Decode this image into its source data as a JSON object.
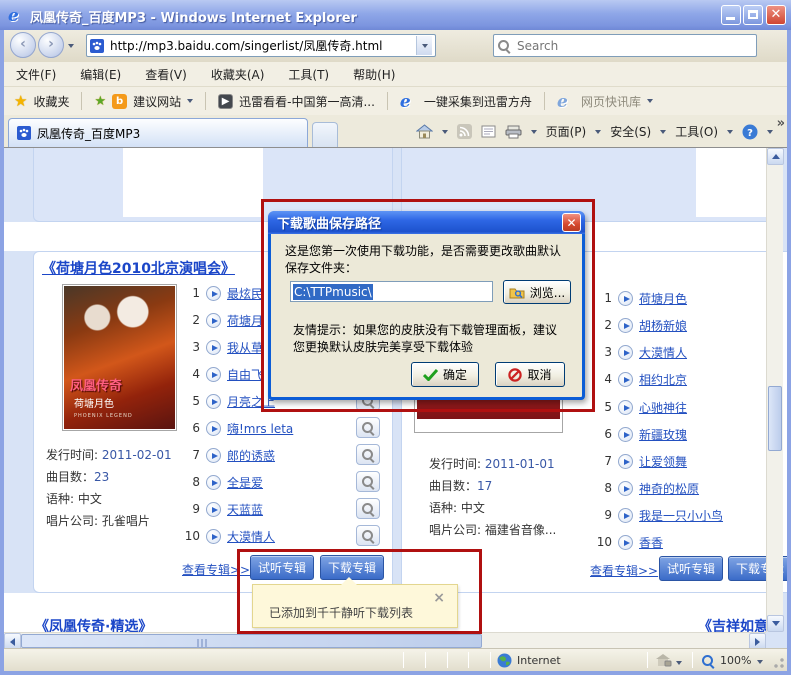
{
  "window": {
    "title": "凤凰传奇_百度MP3 - Windows Internet Explorer"
  },
  "nav": {
    "url": "http://mp3.baidu.com/singerlist/凤凰传奇.html",
    "search_placeholder": "Search"
  },
  "menu": {
    "items": [
      "文件(F)",
      "编辑(E)",
      "查看(V)",
      "收藏夹(A)",
      "工具(T)",
      "帮助(H)"
    ]
  },
  "favorites": {
    "favorites_button": "收藏夹",
    "suggested_sites": "建议网站",
    "xunlei_kankan": "迅雷看看-中国第一高清...",
    "xunlei_collect": "一键采集到迅雷方舟",
    "web_slices": "网页快讯库"
  },
  "tabs": {
    "active": "凤凰传奇_百度MP3"
  },
  "command_bar": {
    "page": "页面(P)",
    "safety": "安全(S)",
    "tools": "工具(O)"
  },
  "page": {
    "album_left": {
      "title": "《荷塘月色2010北京演唱会》",
      "cover": {
        "artist": "凤凰传奇",
        "album": "荷塘月色",
        "subtitle": "PHOENIX LEGEND"
      },
      "info": {
        "release_label": "发行时间:",
        "release": "2011-02-01",
        "count_label": "曲目数：",
        "count": "23",
        "lang_label": "语种:",
        "lang": "中文",
        "company_label": "唱片公司:",
        "company": "孔雀唱片"
      },
      "view_album": "查看专辑>>",
      "listen": "试听专辑",
      "download": "下载专辑",
      "tracks": [
        {
          "no": "1",
          "name": "最炫民"
        },
        {
          "no": "2",
          "name": "荷塘月"
        },
        {
          "no": "3",
          "name": "我从草"
        },
        {
          "no": "4",
          "name": "自由飞"
        },
        {
          "no": "5",
          "name": "月亮之上"
        },
        {
          "no": "6",
          "name": "嗨!mrs leta"
        },
        {
          "no": "7",
          "name": "郎的诱惑"
        },
        {
          "no": "8",
          "name": "全是爱"
        },
        {
          "no": "9",
          "name": "天蓝蓝"
        },
        {
          "no": "10",
          "name": "大漠情人"
        }
      ]
    },
    "album_right": {
      "info": {
        "release_label": "发行时间:",
        "release": "2011-01-01",
        "count_label": "曲目数：",
        "count": "17",
        "lang_label": "语种:",
        "lang": "中文",
        "company_label": "唱片公司:",
        "company": "福建省音像..."
      },
      "view_album": "查看专辑>>",
      "listen": "试听专辑",
      "download": "下载专辑",
      "tracks": [
        {
          "no": "1",
          "name": "荷塘月色"
        },
        {
          "no": "2",
          "name": "胡杨新娘"
        },
        {
          "no": "3",
          "name": "大漠情人"
        },
        {
          "no": "4",
          "name": "相约北京"
        },
        {
          "no": "5",
          "name": "心驰神往"
        },
        {
          "no": "6",
          "name": "新疆玫瑰"
        },
        {
          "no": "7",
          "name": "让爱领舞"
        },
        {
          "no": "8",
          "name": "神奇的松原"
        },
        {
          "no": "9",
          "name": "我是一只小小鸟"
        },
        {
          "no": "10",
          "name": "香香"
        }
      ]
    },
    "next_row": {
      "left_title": "《凤凰传奇·精选》",
      "right_title": "《吉祥如意》"
    }
  },
  "dialog": {
    "title": "下载歌曲保存路径",
    "message_line1": "这是您第一次使用下载功能，是否需要更改歌曲默认",
    "message_line2": "保存文件夹：",
    "path_value": "C:\\TTPmusic\\",
    "browse": "浏览...",
    "tip_line1": "友情提示：如果您的皮肤没有下载管理面板，建议",
    "tip_line2": "您更换默认皮肤完美享受下载体验",
    "ok": "确定",
    "cancel": "取消"
  },
  "toast": {
    "text": "已添加到千千静听下载列表",
    "close": "×"
  },
  "status": {
    "zone": "Internet",
    "zoom": "100%"
  },
  "colors": {
    "annotation": "#B01010",
    "link": "#2350C0",
    "button_blue": "#3A6BC8",
    "selection": "#316AC5",
    "toast_bg": "#FEF8DA"
  }
}
